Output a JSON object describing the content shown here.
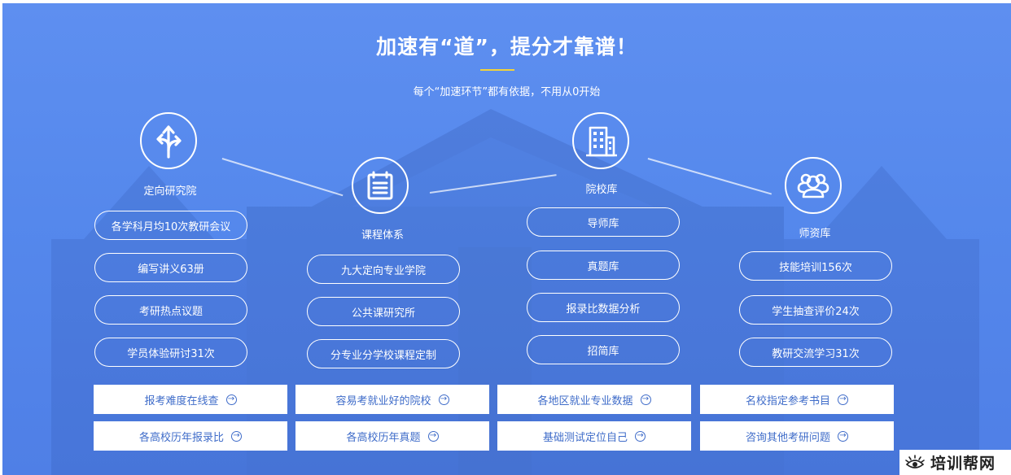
{
  "header": {
    "title": "加速有“道”，提分才靠谱！",
    "subtitle": "每个“加速环节”都有依据，不用从0开始"
  },
  "columns": [
    {
      "icon": "directions-arrow-icon",
      "label": "定向研究院",
      "items": [
        "各学科月均10次教研会议",
        "编写讲义63册",
        "考研热点议题",
        "学员体验研讨31次"
      ]
    },
    {
      "icon": "document-list-icon",
      "label": "课程体系",
      "items": [
        "九大定向专业学院",
        "公共课研究所",
        "分专业分学校课程定制"
      ]
    },
    {
      "icon": "building-icon",
      "label": "院校库",
      "items": [
        "导师库",
        "真题库",
        "报录比数据分析",
        "招简库"
      ]
    },
    {
      "icon": "users-icon",
      "label": "师资库",
      "items": [
        "技能培训156次",
        "学生抽查评价24次",
        "教研交流学习31次"
      ]
    }
  ],
  "quick_links": {
    "row1": [
      "报考难度在线查",
      "容易考就业好的院校",
      "各地区就业专业数据",
      "名校指定参考书目"
    ],
    "row2": [
      "各高校历年报录比",
      "各高校历年真题",
      "基础测试定位自己",
      "咨询其他考研问题"
    ],
    "arrow_glyph": "→"
  },
  "watermark": {
    "icon": "eye-logo-icon",
    "text": "培训帮网"
  },
  "colors": {
    "background": "#5588ec",
    "accent_line": "#f2d33a",
    "link_text": "#3f6cc9"
  }
}
